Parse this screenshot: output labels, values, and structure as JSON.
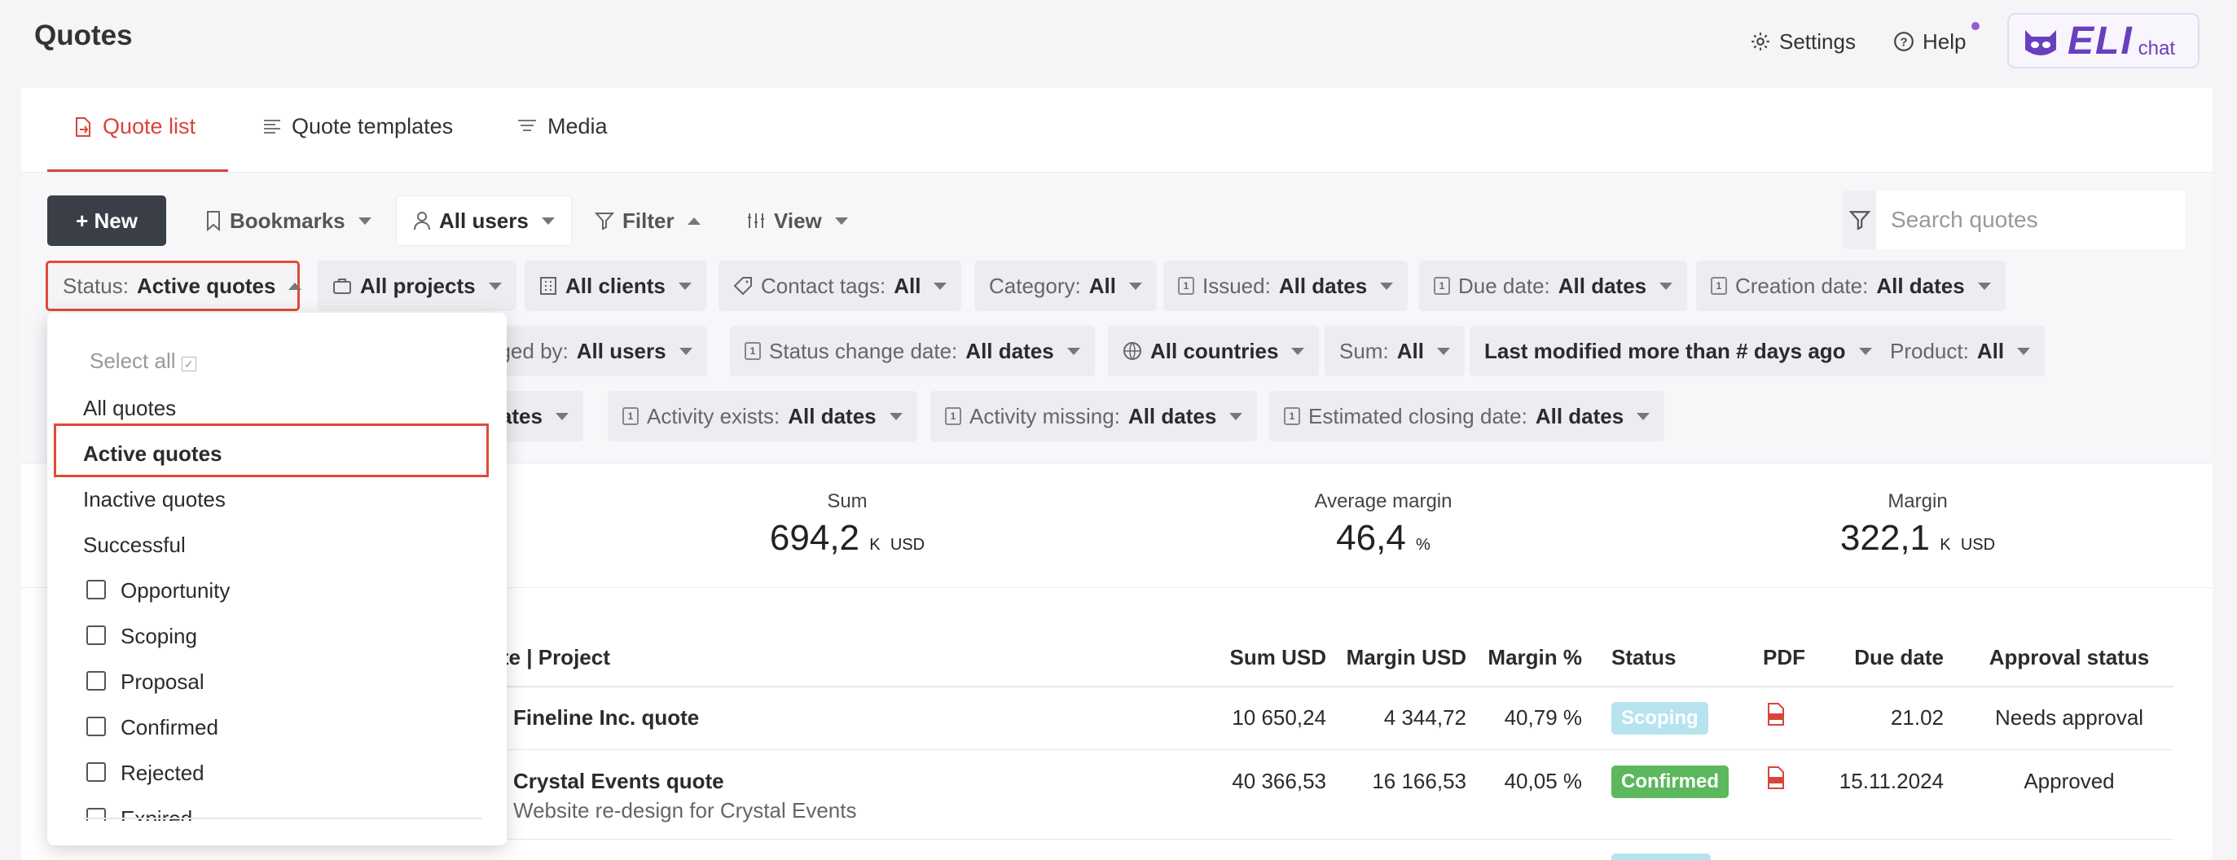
{
  "page": {
    "title": "Quotes"
  },
  "header": {
    "settings_label": "Settings",
    "help_label": "Help",
    "eli_label": "ELI",
    "eli_chat": "chat"
  },
  "tabs": [
    {
      "label": "Quote list",
      "active": true
    },
    {
      "label": "Quote templates",
      "active": false
    },
    {
      "label": "Media",
      "active": false
    }
  ],
  "toolbar": {
    "new_label": "+ New",
    "bookmarks_label": "Bookmarks",
    "users_label": "All users",
    "filter_label": "Filter",
    "view_label": "View",
    "search_placeholder": "Search quotes"
  },
  "filters": {
    "status": {
      "label": "Status:",
      "value": "Active quotes"
    },
    "projects": {
      "value": "All projects"
    },
    "clients": {
      "value": "All clients"
    },
    "contact_tags": {
      "label": "Contact tags:",
      "value": "All"
    },
    "category": {
      "label": "Category:",
      "value": "All"
    },
    "issued": {
      "label": "Issued:",
      "value": "All dates"
    },
    "due_date": {
      "label": "Due date:",
      "value": "All dates"
    },
    "creation_date": {
      "label": "Creation date:",
      "value": "All dates"
    },
    "changed_by": {
      "label": "nged by:",
      "value": "All users"
    },
    "status_change_date": {
      "label": "Status change date:",
      "value": "All dates"
    },
    "countries": {
      "value": "All countries"
    },
    "sum": {
      "label": "Sum:",
      "value": "All"
    },
    "last_modified": {
      "value": "Last modified more than # days ago"
    },
    "product": {
      "label": "Product:",
      "value": "All"
    },
    "partial_dates": {
      "value": "dates"
    },
    "activity_exists": {
      "label": "Activity exists:",
      "value": "All dates"
    },
    "activity_missing": {
      "label": "Activity missing:",
      "value": "All dates"
    },
    "estimated_closing": {
      "label": "Estimated closing date:",
      "value": "All dates"
    }
  },
  "stats": [
    {
      "label": "Sum",
      "value": "694,2",
      "unit_k": "K",
      "unit": "USD"
    },
    {
      "label": "Average margin",
      "value": "46,4",
      "unit_k": "",
      "unit": "%"
    },
    {
      "label": "Margin",
      "value": "322,1",
      "unit_k": "K",
      "unit": "USD"
    }
  ],
  "table": {
    "headers": {
      "quote": "ote | Project",
      "sum": "Sum USD",
      "margin_usd": "Margin USD",
      "margin_pct": "Margin %",
      "status": "Status",
      "pdf": "PDF",
      "due": "Due date",
      "approval": "Approval status"
    },
    "rows": [
      {
        "name": "Fineline Inc. quote",
        "project": "",
        "sum": "10 650,24",
        "margin_usd": "4 344,72",
        "margin_pct": "40,79 %",
        "status": "Scoping",
        "status_color": "#b7e3ef",
        "due": "21.02",
        "approval": "Needs approval"
      },
      {
        "name": "Crystal Events quote",
        "project": "Website re-design for Crystal Events",
        "sum": "40 366,53",
        "margin_usd": "16 166,53",
        "margin_pct": "40,05 %",
        "status": "Confirmed",
        "status_color": "#5cb85c",
        "due": "15.11.2024",
        "approval": "Approved"
      }
    ]
  },
  "dropdown": {
    "select_all": "Select all",
    "groups": [
      "All quotes",
      "Active quotes",
      "Inactive quotes",
      "Successful"
    ],
    "statuses": [
      "Opportunity",
      "Scoping",
      "Proposal",
      "Confirmed",
      "Rejected",
      "Expired"
    ]
  },
  "colors": {
    "accent": "#d6453d",
    "highlight_border": "#e24a35",
    "dark_button": "#3a3f47",
    "eli_purple": "#6a3fbf"
  }
}
